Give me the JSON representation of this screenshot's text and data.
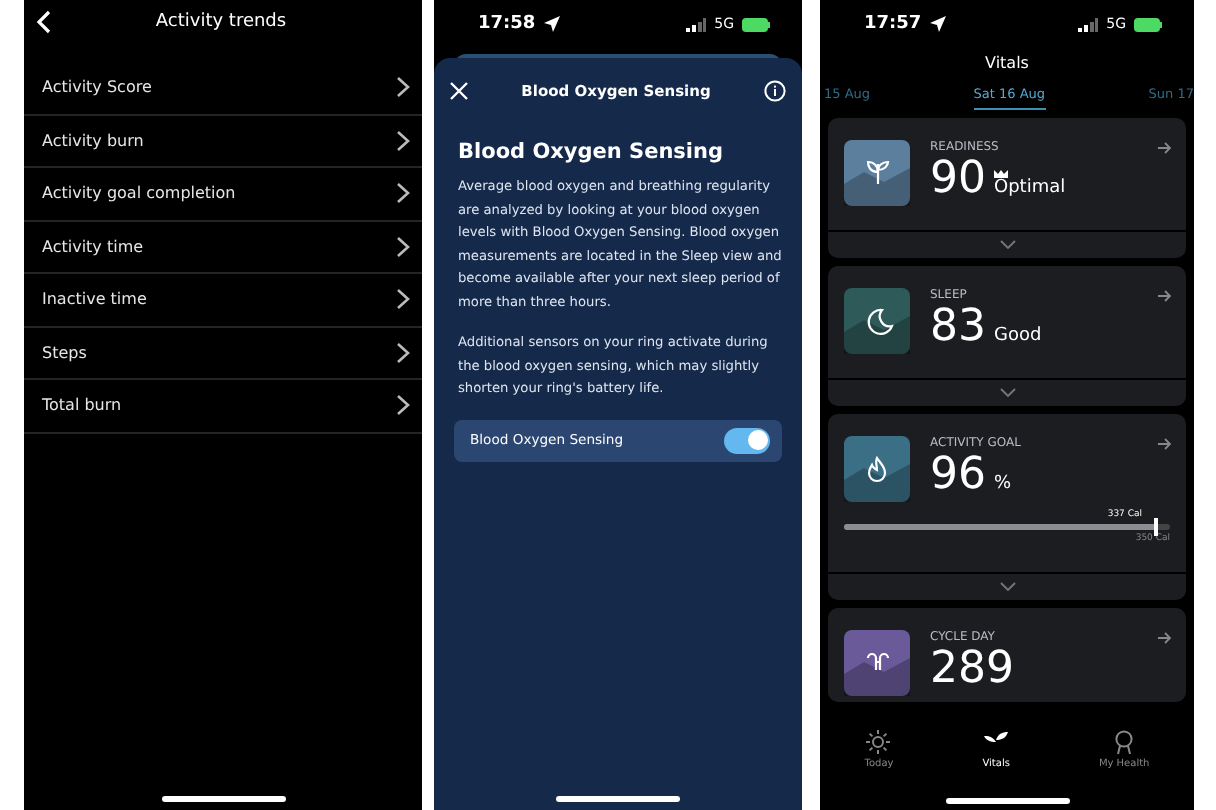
{
  "activity_trends": {
    "title": "Activity trends",
    "items": [
      {
        "label": "Activity Score"
      },
      {
        "label": "Activity burn"
      },
      {
        "label": "Activity goal completion"
      },
      {
        "label": "Activity time"
      },
      {
        "label": "Inactive time"
      },
      {
        "label": "Steps"
      },
      {
        "label": "Total burn"
      }
    ]
  },
  "blood_oxygen": {
    "status_time": "17:58",
    "network": "5G",
    "sheet_title": "Blood Oxygen Sensing",
    "heading": "Blood Oxygen Sensing",
    "paragraphs": [
      "Average blood oxygen and breathing regularity are analyzed by looking at your blood oxygen levels with Blood Oxygen Sensing. Blood oxygen measurements are located in the Sleep view and become available after your next sleep period of more than three hours.",
      "Additional sensors on your ring activate during the blood oxygen sensing, which may slightly shorten your ring's battery life."
    ],
    "toggle": {
      "label": "Blood Oxygen Sensing",
      "on": true
    }
  },
  "vitals": {
    "status_time": "17:57",
    "network": "5G",
    "title": "Vitals",
    "dates": [
      {
        "label": "15 Aug",
        "selected": false
      },
      {
        "label": "Sat 16 Aug",
        "selected": true
      },
      {
        "label": "Sun 17",
        "selected": false
      }
    ],
    "cards": [
      {
        "kind": "score",
        "label": "READINESS",
        "value": "90",
        "note": "Optimal",
        "crown": true,
        "color": "#5d7f9e"
      },
      {
        "kind": "score",
        "label": "SLEEP",
        "value": "83",
        "note": "Good",
        "crown": false,
        "color": "#2f5a5a"
      },
      {
        "kind": "goal",
        "label": "ACTIVITY GOAL",
        "value": "96",
        "note": "%",
        "crown": false,
        "color": "#3a6f86",
        "progress": {
          "level": 0.96,
          "current": "337 Cal",
          "target": "350 Cal"
        }
      },
      {
        "kind": "cycle",
        "label": "CYCLE DAY",
        "value": "289",
        "color": "#6a5a9a"
      }
    ],
    "nav": [
      {
        "label": "Today",
        "selected": false
      },
      {
        "label": "Vitals",
        "selected": true
      },
      {
        "label": "My Health",
        "selected": false
      }
    ]
  }
}
